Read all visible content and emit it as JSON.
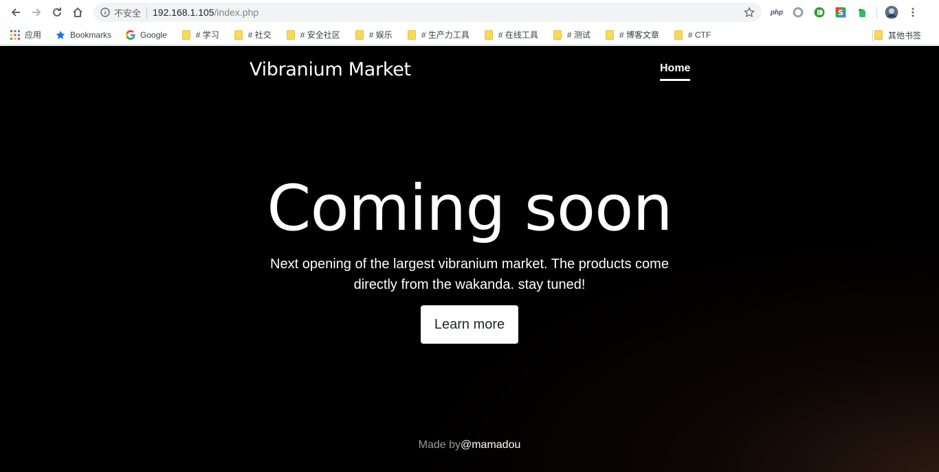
{
  "browser": {
    "security_label": "不安全",
    "url_host": "192.168.1.105",
    "url_path": "/index.php",
    "extensions": [
      "php-icon",
      "circle-extension-icon",
      "green-d-extension-icon",
      "s-extension-icon",
      "evernote-icon",
      "profile-avatar-icon",
      "menu-kebab-icon"
    ],
    "ext_php_label": "php"
  },
  "bookmarks": {
    "apps_label": "应用",
    "items": [
      {
        "label": "Bookmarks",
        "icon": "star-icon"
      },
      {
        "label": "Google",
        "icon": "google-icon"
      },
      {
        "label": "# 学习",
        "icon": "folder-icon"
      },
      {
        "label": "#  社交",
        "icon": "folder-icon"
      },
      {
        "label": "#  安全社区",
        "icon": "folder-icon"
      },
      {
        "label": "#  娱乐",
        "icon": "folder-icon"
      },
      {
        "label": "#  生产力工具",
        "icon": "folder-icon"
      },
      {
        "label": "# 在线工具",
        "icon": "folder-icon"
      },
      {
        "label": "# 测试",
        "icon": "folder-icon"
      },
      {
        "label": "# 博客文章",
        "icon": "folder-icon"
      },
      {
        "label": "# CTF",
        "icon": "folder-icon"
      }
    ],
    "other_label": "其他书签"
  },
  "site": {
    "brand": "Vibranium Market",
    "nav_home": "Home",
    "hero_title": "Coming soon",
    "hero_lead": "Next opening of the largest vibranium market. The products come directly from the wakanda. stay tuned!",
    "cta_label": "Learn more",
    "footer_prefix": "Made by",
    "footer_author": "@mamadou"
  }
}
